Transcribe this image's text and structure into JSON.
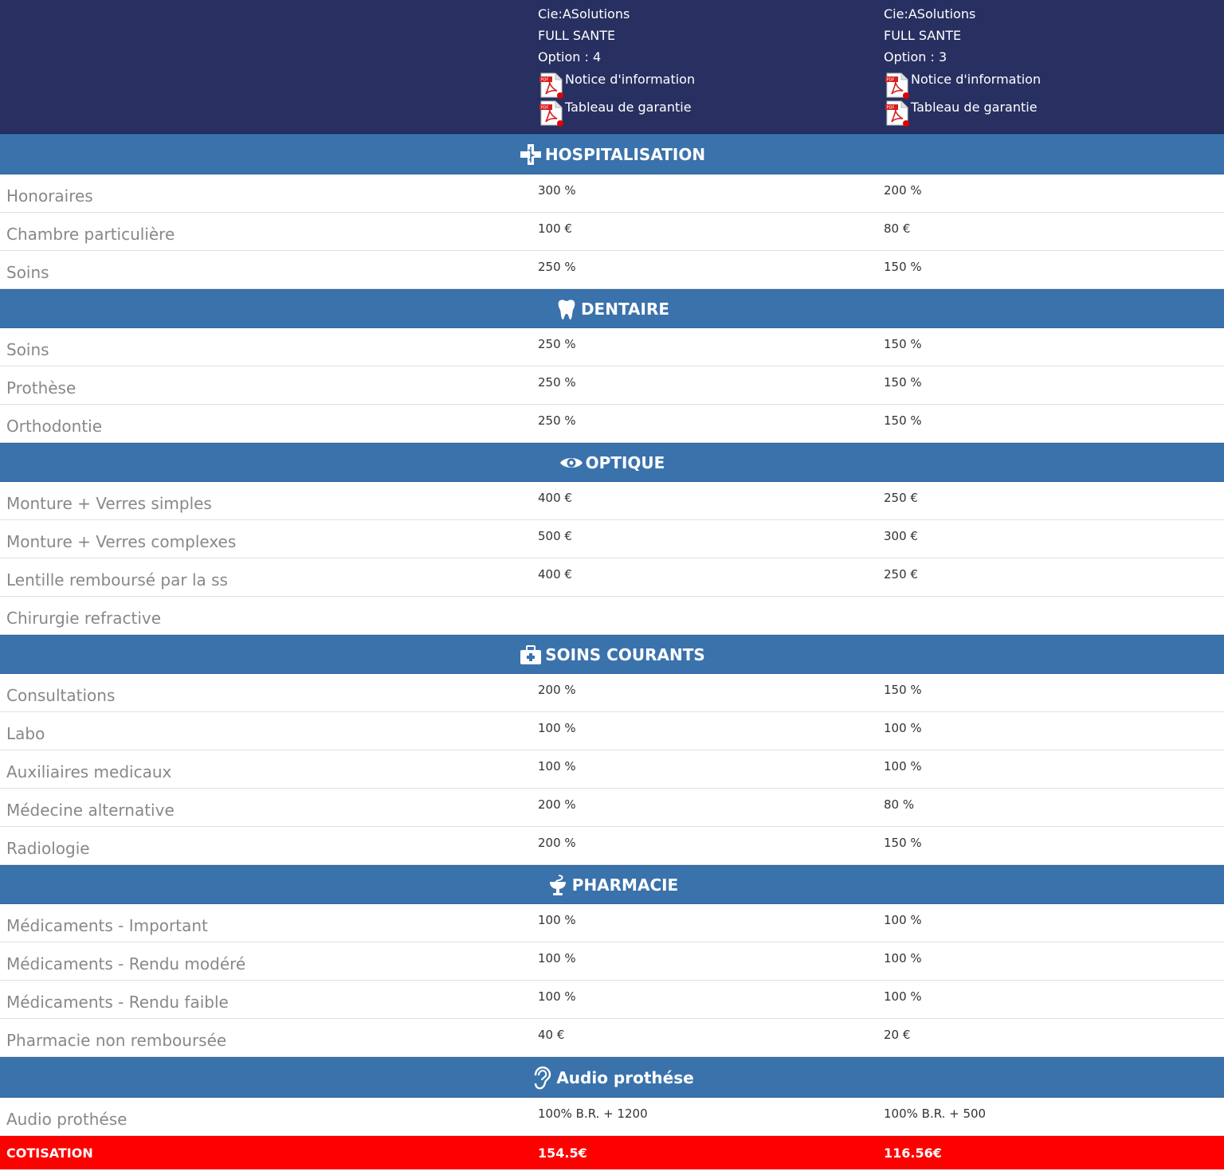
{
  "plans": [
    {
      "company": "Cie:ASolutions",
      "product": "FULL SANTE",
      "option": "Option : 4",
      "notice_label": "Notice d'information",
      "garantie_label": "Tableau de garantie"
    },
    {
      "company": "Cie:ASolutions",
      "product": "FULL SANTE",
      "option": "Option : 3",
      "notice_label": "Notice d'information",
      "garantie_label": "Tableau de garantie"
    }
  ],
  "sections": [
    {
      "title": "HOSPITALISATION",
      "icon": "hospital-cross-icon",
      "rows": [
        {
          "label": "Honoraires",
          "v1": "300 %",
          "v2": "200 %"
        },
        {
          "label": "Chambre particulière",
          "v1": "100 €",
          "v2": "80 €"
        },
        {
          "label": "Soins",
          "v1": "250 %",
          "v2": "150 %"
        }
      ]
    },
    {
      "title": "DENTAIRE",
      "icon": "tooth-icon",
      "rows": [
        {
          "label": "Soins",
          "v1": "250 %",
          "v2": "150 %"
        },
        {
          "label": "Prothèse",
          "v1": "250 %",
          "v2": "150 %"
        },
        {
          "label": "Orthodontie",
          "v1": "250 %",
          "v2": "150 %"
        }
      ]
    },
    {
      "title": "OPTIQUE",
      "icon": "eye-icon",
      "rows": [
        {
          "label": "Monture + Verres simples",
          "v1": "400 €",
          "v2": "250 €"
        },
        {
          "label": "Monture + Verres complexes",
          "v1": "500 €",
          "v2": "300 €"
        },
        {
          "label": "Lentille remboursé par la ss",
          "v1": "400 €",
          "v2": "250 €"
        },
        {
          "label": "Chirurgie refractive",
          "v1": "",
          "v2": ""
        }
      ]
    },
    {
      "title": "SOINS COURANTS",
      "icon": "medical-kit-icon",
      "rows": [
        {
          "label": "Consultations",
          "v1": "200 %",
          "v2": "150 %"
        },
        {
          "label": "Labo",
          "v1": "100 %",
          "v2": "100 %"
        },
        {
          "label": "Auxiliaires medicaux",
          "v1": "100 %",
          "v2": "100 %"
        },
        {
          "label": "Médecine alternative",
          "v1": "200 %",
          "v2": "80 %"
        },
        {
          "label": "Radiologie",
          "v1": "200 %",
          "v2": "150 %"
        }
      ]
    },
    {
      "title": "PHARMACIE",
      "icon": "pharmacy-bowl-icon",
      "rows": [
        {
          "label": "Médicaments - Important",
          "v1": "100 %",
          "v2": "100 %"
        },
        {
          "label": "Médicaments - Rendu modéré",
          "v1": "100 %",
          "v2": "100 %"
        },
        {
          "label": "Médicaments - Rendu faible",
          "v1": "100 %",
          "v2": "100 %"
        },
        {
          "label": "Pharmacie non remboursée",
          "v1": "40 €",
          "v2": "20 €"
        }
      ]
    },
    {
      "title": "Audio prothése",
      "icon": "ear-icon",
      "rows": [
        {
          "label": "Audio prothése",
          "v1": "100% B.R. + 1200",
          "v2": "100% B.R. + 500"
        }
      ]
    }
  ],
  "cotisation": {
    "label": "COTISATION",
    "v1": "154.5€",
    "v2": "116.56€"
  },
  "colors": {
    "header_bg": "#283061",
    "section_bg": "#3a72ac",
    "cotisation_bg": "#ff0000",
    "label_text": "#888888"
  }
}
